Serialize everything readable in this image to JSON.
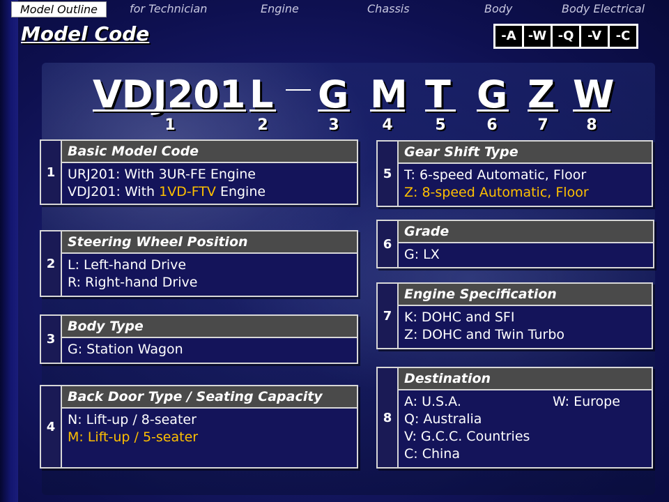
{
  "nav": {
    "items": [
      "Model Outline",
      "for Technician",
      "Engine",
      "Chassis",
      "Body",
      "Body Electrical"
    ]
  },
  "page_title": "Model Code",
  "suffixes": [
    "-A",
    "-W",
    "-Q",
    "-V",
    "-C"
  ],
  "code": {
    "chars": [
      "VDJ201",
      "L",
      "G",
      "M",
      "T",
      "G",
      "Z",
      "W"
    ],
    "numbers": [
      "1",
      "2",
      "3",
      "4",
      "5",
      "6",
      "7",
      "8"
    ]
  },
  "boxes": {
    "b1": {
      "num": "1",
      "title": "Basic Model Code",
      "line1": "URJ201: With 3UR-FE Engine",
      "line2_pre": "VDJ201: With ",
      "line2_hl": "1VD-FTV",
      "line2_post": " Engine"
    },
    "b2": {
      "num": "2",
      "title": "Steering Wheel Position",
      "line1": "L: Left-hand Drive",
      "line2": "R: Right-hand Drive"
    },
    "b3": {
      "num": "3",
      "title": "Body Type",
      "line1": "G: Station Wagon"
    },
    "b4": {
      "num": "4",
      "title": "Back Door Type / Seating Capacity",
      "line1": "N: Lift-up / 8-seater",
      "line2": "M: Lift-up / 5-seater"
    },
    "b5": {
      "num": "5",
      "title": "Gear Shift Type",
      "line1": "T: 6-speed Automatic, Floor",
      "line2": "Z: 8-speed Automatic, Floor"
    },
    "b6": {
      "num": "6",
      "title": "Grade",
      "line1": "G: LX"
    },
    "b7": {
      "num": "7",
      "title": "Engine Specification",
      "line1": "K: DOHC and SFI",
      "line2": "Z: DOHC and Twin Turbo"
    },
    "b8": {
      "num": "8",
      "title": "Destination",
      "line1a": "A: U.S.A.",
      "line1b": "W: Europe",
      "line2": "Q: Australia",
      "line3": "V: G.C.C. Countries",
      "line4": "C: China"
    }
  },
  "colors": {
    "highlight": "#ffc000",
    "header_bg": "#4a4a4a",
    "body_bg": "#14145a"
  }
}
